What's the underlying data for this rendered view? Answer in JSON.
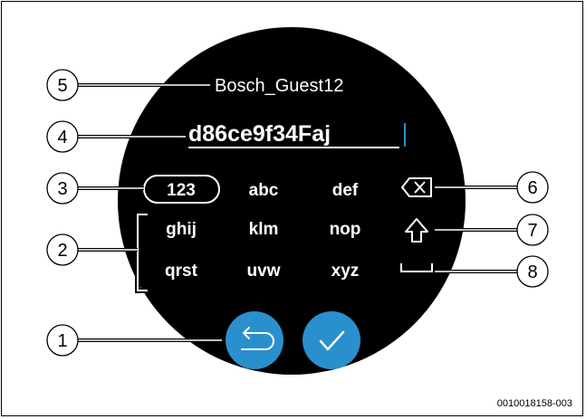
{
  "screen": {
    "network_name": "Bosch_Guest12",
    "password_value": "d86ce9f34Faj",
    "mode_key": "123",
    "keys_row1": [
      "abc",
      "def"
    ],
    "keys_row2": [
      "ghij",
      "klm",
      "nop"
    ],
    "keys_row3": [
      "qrst",
      "uvw",
      "xyz"
    ],
    "icons": {
      "backspace": "backspace-icon",
      "shift": "shift-icon",
      "space": "space-icon",
      "back": "back-arrow-icon",
      "confirm": "checkmark-icon"
    },
    "colors": {
      "display_background": "#000000",
      "button_blue": "#2a8fcd",
      "text": "#ffffff"
    }
  },
  "callouts": [
    "1",
    "2",
    "3",
    "4",
    "5",
    "6",
    "7",
    "8"
  ],
  "document_id": "0010018158-003"
}
